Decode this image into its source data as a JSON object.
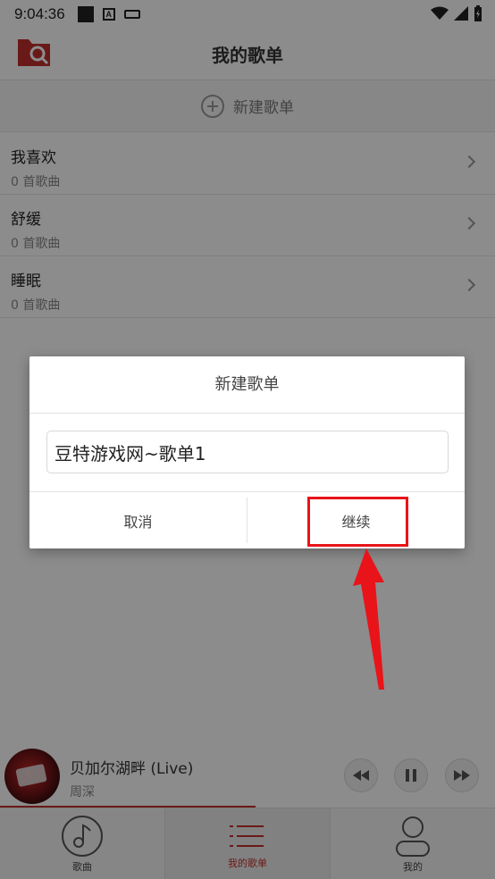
{
  "status_bar": {
    "time": "9:04:36"
  },
  "header": {
    "title": "我的歌单"
  },
  "new_playlist": {
    "label": "新建歌单"
  },
  "playlists": [
    {
      "name": "我喜欢",
      "count": "0 首歌曲"
    },
    {
      "name": "舒缓",
      "count": "0 首歌曲"
    },
    {
      "name": "睡眠",
      "count": "0 首歌曲"
    }
  ],
  "player": {
    "title": "贝加尔湖畔 (Live)",
    "artist": "周深"
  },
  "tabs": [
    {
      "label": "歌曲",
      "icon": "music-note-icon"
    },
    {
      "label": "我的歌单",
      "icon": "list-icon"
    },
    {
      "label": "我的",
      "icon": "person-icon"
    }
  ],
  "dialog": {
    "title": "新建歌单",
    "input_value": "豆特游戏网~歌单1",
    "cancel": "取消",
    "continue": "继续"
  },
  "colors": {
    "accent": "#c0302c",
    "annotation": "#e8141a"
  }
}
